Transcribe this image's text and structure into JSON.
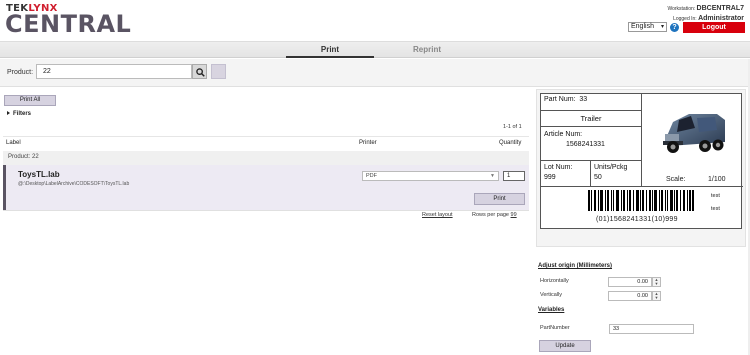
{
  "header": {
    "logo_top_prefix": "TEK",
    "logo_top_suffix": "LYNX",
    "logo_main": "CENTRAL",
    "workstation_label": "Workstation:",
    "workstation_value": "DBCENTRAL7",
    "logged_in_label": "Logged In:",
    "logged_in_value": "Administrator",
    "language": "English",
    "help_icon": "question-circle-icon",
    "logout_label": "Logout",
    "logout_color": "#d8000c"
  },
  "tabs": [
    {
      "label": "Print",
      "active": true
    },
    {
      "label": "Reprint",
      "active": false
    }
  ],
  "search": {
    "product_label": "Product:",
    "product_value": "22",
    "search_icon": "magnifier-icon"
  },
  "list": {
    "print_all_label": "Print All",
    "filters_label": "Filters",
    "paging": "1-1 of 1",
    "columns": {
      "label": "Label",
      "printer": "Printer",
      "quantity": "Quantity"
    },
    "group": "Product: 22",
    "rows": [
      {
        "name": "ToysTL.lab",
        "path": "@:\\Desktop\\LabelArchive\\CODESOFT\\ToysTL.lab",
        "printer": "PDF",
        "quantity": "1",
        "print_label": "Print"
      }
    ],
    "reset_layout": "Reset layout",
    "rows_per_page_label": "Rows per page",
    "rows_per_page_value": "99"
  },
  "preview": {
    "part_num_label": "Part Num:",
    "part_num_value": "33",
    "trailer": "Trailer",
    "article_label": "Article Num:",
    "article_value": "1568241331",
    "lot_label": "Lot Num:",
    "lot_value": "999",
    "units_label": "Units/Pckg",
    "units_value": "50",
    "scale_label": "Scale:",
    "scale_value": "1/100",
    "barcode_text": "(01)1568241331(10)999",
    "test_1": "test",
    "test_2": "test",
    "image_icon": "truck-icon"
  },
  "adjust": {
    "title": "Adjust origin (Millimeters)",
    "horizontally_label": "Horizontally",
    "horizontally_value": "0.00",
    "vertically_label": "Vertically",
    "vertically_value": "0.00"
  },
  "variables": {
    "title": "Variables",
    "items": [
      {
        "name": "PartNumber",
        "value": "33"
      }
    ],
    "update_label": "Update"
  }
}
